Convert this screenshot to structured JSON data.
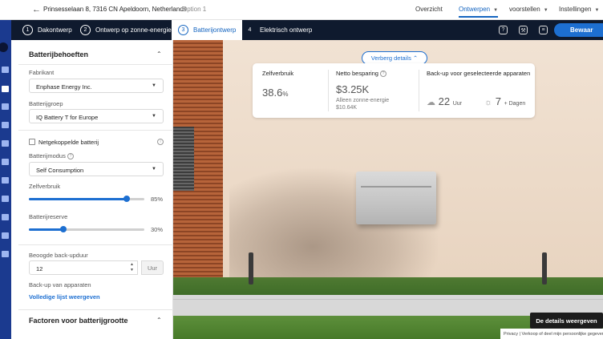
{
  "topbar": {
    "address": "Prinsesselaan 8, 7316 CN Apeldoorn, Netherlands",
    "option": "Option 1",
    "nav": [
      {
        "label": "Overzicht",
        "active": false,
        "dropdown": false
      },
      {
        "label": "Ontwerpen",
        "active": true,
        "dropdown": true
      },
      {
        "label": "voorstellen",
        "active": false,
        "dropdown": true
      },
      {
        "label": "Instellingen",
        "active": false,
        "dropdown": true
      }
    ]
  },
  "steps": [
    {
      "num": "1",
      "label": "Dakontwerp"
    },
    {
      "num": "2",
      "label": "Ontwerp op zonne-energie"
    },
    {
      "num": "3",
      "label": "Batterijontwerp"
    },
    {
      "num": "4",
      "label": "Elektrisch ontwerp"
    }
  ],
  "save_label": "Bewaar",
  "panel": {
    "title": "Batterijbehoeften",
    "manufacturer_label": "Fabrikant",
    "manufacturer_value": "Enphase Energy Inc.",
    "group_label": "Batterijgroep",
    "group_value": "IQ Battery T for Europe",
    "grid_tied_label": "Netgekoppelde batterij",
    "mode_label": "Batterijmodus",
    "mode_value": "Self Consumption",
    "self_consumption_label": "Zelfverbruik",
    "self_consumption_value": "85%",
    "self_consumption_level": 0.85,
    "reserve_label": "Batterijreserve",
    "reserve_value": "30%",
    "reserve_level": 0.3,
    "backup_duration_label": "Beoogde back-upduur",
    "backup_duration_value": "12",
    "backup_duration_unit": "Uur",
    "backup_devices_label": "Back-up van apparaten",
    "full_list_link": "Volledige lijst weergeven",
    "factors_title": "Factoren voor batterijgrootte"
  },
  "scene": {
    "hide_details_label": "Verberg details",
    "stats": {
      "self_consumption_title": "Zelfverbruik",
      "self_consumption_value": "38.6",
      "self_consumption_unit": "%",
      "savings_title": "Netto besparing",
      "savings_value": "$3.25K",
      "savings_sub_label": "Alleen zonne-energie",
      "savings_sub_value": "$10.64K",
      "backup_title": "Back-up voor geselecteerde apparaten",
      "backup_cloudy_value": "22",
      "backup_cloudy_unit": "Uur",
      "backup_sunny_value": "7",
      "backup_sunny_unit": "+ Dagen"
    },
    "show_details_label": "De details weergeven",
    "footer_text": "Privacy  |  Verkoop of deel mijn persoonlijke gegevens niet"
  }
}
